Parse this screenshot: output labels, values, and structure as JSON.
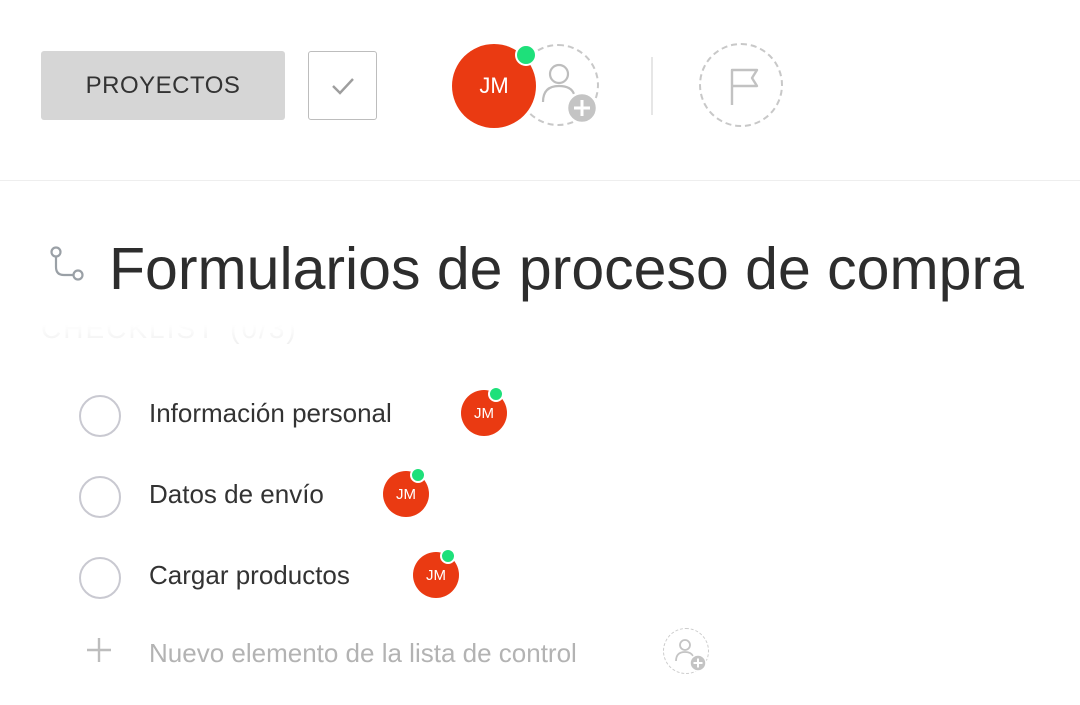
{
  "toolbar": {
    "projects_label": "PROYECTOS",
    "complete_icon": "check-icon",
    "assignee_initials": "JM",
    "add_member_icon": "add-person-icon",
    "milestone_icon": "flag-icon"
  },
  "task": {
    "icon": "subtask-icon",
    "title": "Formularios de proceso de compra"
  },
  "checklist": {
    "section_label": "CHECKLIST",
    "count": "(0/3)",
    "items": [
      {
        "label": "Información personal",
        "assignee": "JM",
        "done": false
      },
      {
        "label": "Datos de envío",
        "assignee": "JM",
        "done": false
      },
      {
        "label": "Cargar productos",
        "assignee": "JM",
        "done": false
      }
    ],
    "new_item_placeholder": "Nuevo elemento de la lista de control"
  },
  "colors": {
    "accent": "#ea3a12",
    "online": "#1ee07a",
    "button_bg": "#d6d6d6",
    "border": "#c9c9d1"
  }
}
